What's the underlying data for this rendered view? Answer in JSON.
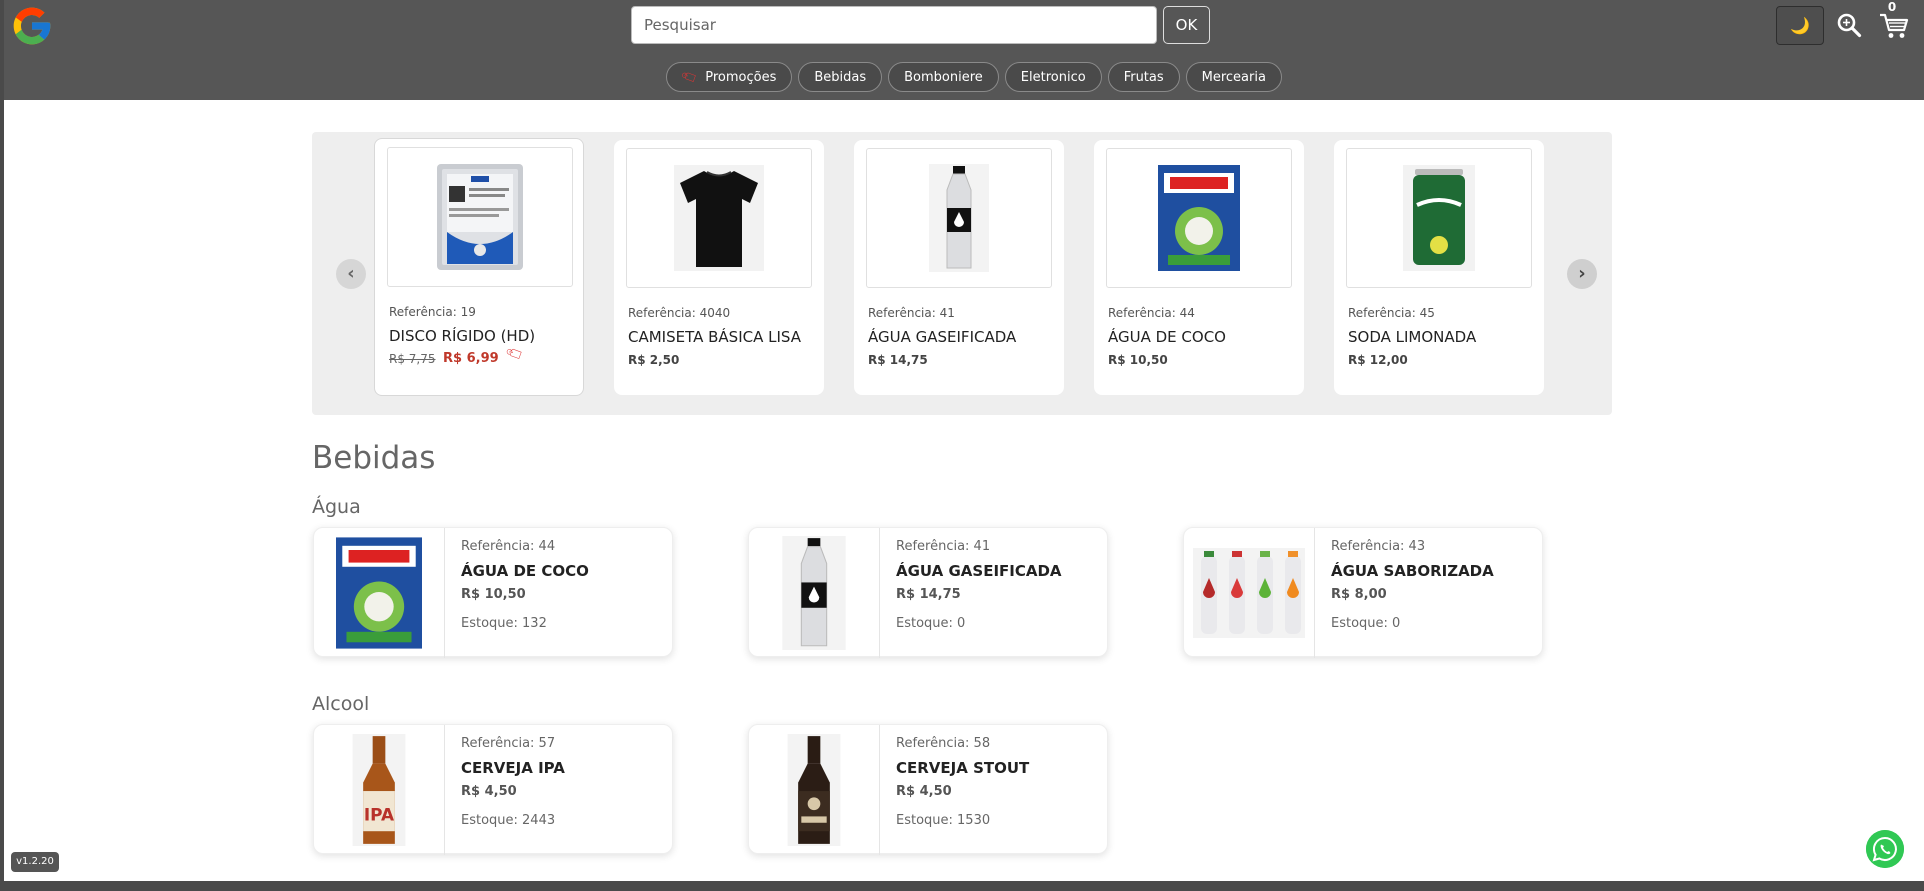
{
  "header": {
    "search_placeholder": "Pesquisar",
    "ok_label": "OK",
    "theme_glyph": "🌙",
    "cart_count": "0",
    "icons": [
      "google-logo",
      "moon-icon",
      "search-zoom-icon",
      "cart-icon"
    ]
  },
  "categories": [
    {
      "label": "Promoções",
      "icon": "sale-tag-icon"
    },
    {
      "label": "Bebidas"
    },
    {
      "label": "Bomboniere"
    },
    {
      "label": "Eletronico"
    },
    {
      "label": "Frutas"
    },
    {
      "label": "Mercearia"
    }
  ],
  "carousel": {
    "prev": "‹",
    "next": "›",
    "items": [
      {
        "ref": "Referência: 19",
        "name": "DISCO RÍGIDO (HD)",
        "old_price": "R$ 7,75",
        "price": "R$ 6,99",
        "tag": "sale-tag-icon"
      },
      {
        "ref": "Referência: 4040",
        "name": "CAMISETA BÁSICA LISA",
        "price": "R$ 2,50"
      },
      {
        "ref": "Referência: 41",
        "name": "ÁGUA GASEIFICADA",
        "price": "R$ 14,75"
      },
      {
        "ref": "Referência: 44",
        "name": "ÁGUA DE COCO",
        "price": "R$ 10,50"
      },
      {
        "ref": "Referência: 45",
        "name": "SODA LIMONADA",
        "price": "R$ 12,00"
      }
    ]
  },
  "section": {
    "title": "Bebidas",
    "groups": [
      {
        "title": "Água",
        "items": [
          {
            "ref": "Referência: 44",
            "name": "ÁGUA DE COCO",
            "price": "R$ 10,50",
            "stock": "Estoque: 132"
          },
          {
            "ref": "Referência: 41",
            "name": "ÁGUA GASEIFICADA",
            "price": "R$ 14,75",
            "stock": "Estoque: 0"
          },
          {
            "ref": "Referência: 43",
            "name": "ÁGUA SABORIZADA",
            "price": "R$ 8,00",
            "stock": "Estoque: 0"
          }
        ]
      },
      {
        "title": "Alcool",
        "items": [
          {
            "ref": "Referência: 57",
            "name": "CERVEJA IPA",
            "price": "R$ 4,50",
            "stock": "Estoque: 2443"
          },
          {
            "ref": "Referência: 58",
            "name": "CERVEJA STOUT",
            "price": "R$ 4,50",
            "stock": "Estoque: 1530"
          }
        ]
      }
    ]
  },
  "version": "v1.2.20",
  "colors": {
    "header_bg": "#565656",
    "sale_red": "#c0392b",
    "whatsapp": "#30c854"
  }
}
